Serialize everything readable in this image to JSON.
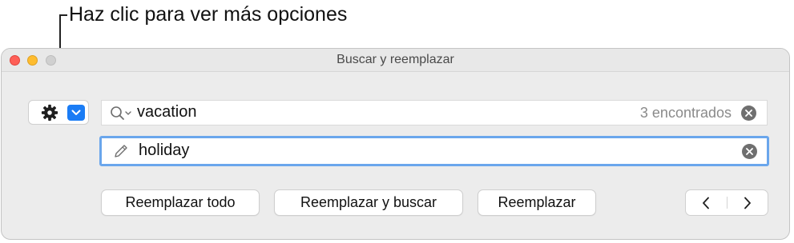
{
  "callout": {
    "text": "Haz clic para ver más opciones"
  },
  "window": {
    "title": "Buscar y reemplazar"
  },
  "options": {
    "gear_icon": "gear-icon",
    "chevron_icon": "chevron-down-icon",
    "accent_color": "#1a7cf5"
  },
  "find": {
    "value": "vacation",
    "match_count": "3 encontrados",
    "search_icon": "search-icon"
  },
  "replace": {
    "value": "holiday",
    "pencil_icon": "pencil-icon",
    "focus_color": "#6aa6ec"
  },
  "buttons": {
    "replace_all": "Reemplazar todo",
    "replace_and_find": "Reemplazar y buscar",
    "replace": "Reemplazar",
    "previous_icon": "chevron-left-icon",
    "next_icon": "chevron-right-icon"
  },
  "traffic_lights": {
    "close_color": "#fe5f57",
    "minimize_color": "#febc2e",
    "zoom_color": "#d0d0d0"
  }
}
